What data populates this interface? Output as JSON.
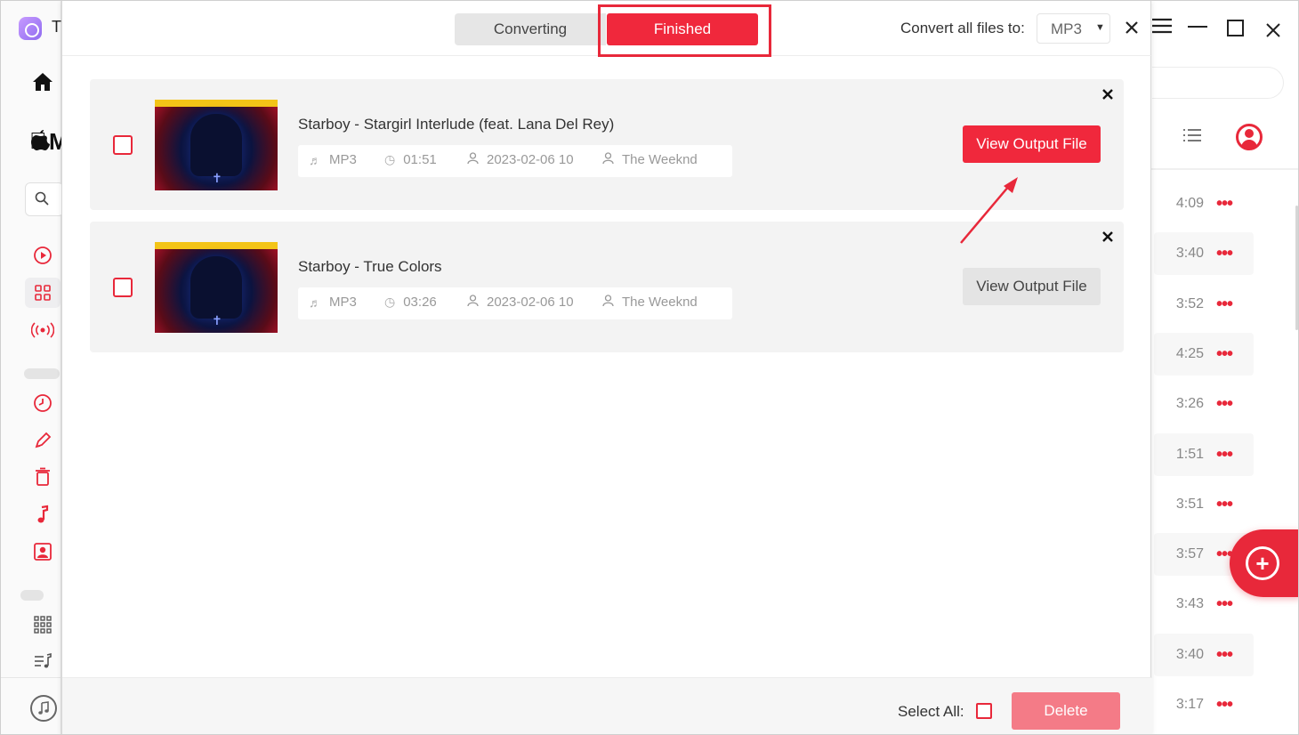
{
  "app": {
    "title_letter": "T",
    "apple_letter": "M",
    "search_glyph": "⌕"
  },
  "dialog": {
    "tabs": {
      "converting": "Converting",
      "finished": "Finished"
    },
    "convert_all_label": "Convert all files to:",
    "format_value": "MP3",
    "close_glyph": "✕"
  },
  "songs": [
    {
      "title": "Starboy - Stargirl Interlude (feat. Lana Del Rey)",
      "format": "MP3",
      "duration": "01:51",
      "date": "2023-02-06 10",
      "artist": "The Weeknd",
      "button": "View Output File",
      "button_style": "primary",
      "cover_icon": "starboy-album-cover"
    },
    {
      "title": "Starboy - True Colors",
      "format": "MP3",
      "duration": "03:26",
      "date": "2023-02-06 10",
      "artist": "The Weeknd",
      "button": "View Output File",
      "button_style": "secondary",
      "cover_icon": "starboy-album-cover"
    }
  ],
  "footer": {
    "select_all_label": "Select All:",
    "delete_label": "Delete"
  },
  "right_panel": {
    "durations": [
      "4:09",
      "3:40",
      "3:52",
      "4:25",
      "3:26",
      "1:51",
      "3:51",
      "3:57",
      "3:43",
      "3:40",
      "3:17"
    ]
  },
  "colors": {
    "accent": "#e8283a",
    "finished_tab": "#f0283c",
    "delete_disabled": "#f47b87",
    "card_bg": "#f3f3f3"
  },
  "icons": {
    "sidebar": [
      "home-icon",
      "apple-logo-icon",
      "search-icon",
      "play-circle-icon",
      "grid-icon",
      "radio-icon",
      "clock-icon",
      "pen-icon",
      "trash-icon",
      "music-note-icon",
      "contact-icon",
      "apps-grid-icon",
      "playlist-icon",
      "itunes-icon"
    ],
    "meta": [
      "music-file-icon",
      "clock-icon",
      "person-icon",
      "artist-icon"
    ]
  }
}
